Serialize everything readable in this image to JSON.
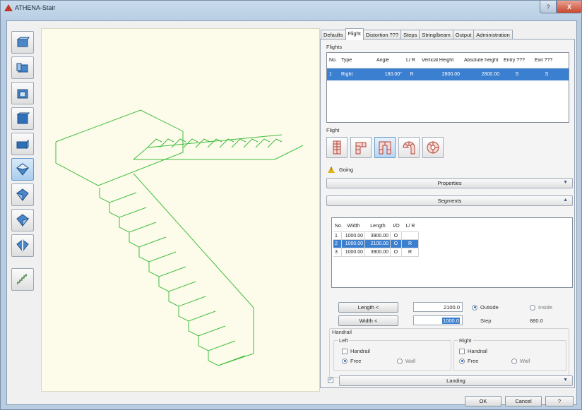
{
  "window": {
    "title": "ATHENA-Stair",
    "help_label": "?",
    "close_label": "X"
  },
  "tabs": [
    "Defaults",
    "Flight",
    "Distortion ???",
    "Steps",
    "String/beam",
    "Output",
    "Administration"
  ],
  "flights": {
    "group_label": "Flights",
    "headers": [
      "No.",
      "Type",
      "Angle",
      "L/ R",
      "Vertical Height",
      "Absolute height",
      "Entry ???",
      "Exit ???"
    ],
    "rows": [
      [
        "1",
        "Right",
        "180.00°",
        "R",
        "2800.00",
        "2800.00",
        "S",
        "S"
      ]
    ]
  },
  "flight_section": {
    "label": "Flight",
    "icons": [
      "straight-flight-icon",
      "l-shaped-flight-icon",
      "u-shaped-flight-icon",
      "half-turn-winder-icon",
      "spiral-flight-icon"
    ],
    "warning_text": "Going"
  },
  "properties_bar": {
    "label": "Properties"
  },
  "segments_bar": {
    "label": "Segments"
  },
  "segments": {
    "headers": [
      "No.",
      "Width",
      "Length",
      "I/O",
      "L/ R"
    ],
    "rows": [
      [
        "1",
        "1000.00",
        "3900.00",
        "O",
        ""
      ],
      [
        "2",
        "1000.00",
        "2100.00",
        "O",
        "R"
      ],
      [
        "3",
        "1000.00",
        "3900.00",
        "O",
        "R"
      ]
    ]
  },
  "segment_edit": {
    "length_button": "Length <",
    "length_value": "2100.0",
    "width_button": "Width <",
    "width_value": "1000.0",
    "outside_label": "Outside",
    "inside_label": "Inside",
    "step_label": "Step",
    "step_value": "880.0"
  },
  "handrail": {
    "group_label": "Handrail",
    "left_label": "Left",
    "right_label": "Right",
    "handrail_label": "Handrail",
    "free_label": "Free",
    "wall_label": "Wall"
  },
  "landing_bar": {
    "label": "Landing"
  },
  "footer": {
    "ok": "OK",
    "cancel": "Cancel",
    "help": "?"
  },
  "colors": {
    "accent": "#3b7fd0",
    "stair_line": "#3fbf3f",
    "canvas_bg": "#fdfbea"
  }
}
